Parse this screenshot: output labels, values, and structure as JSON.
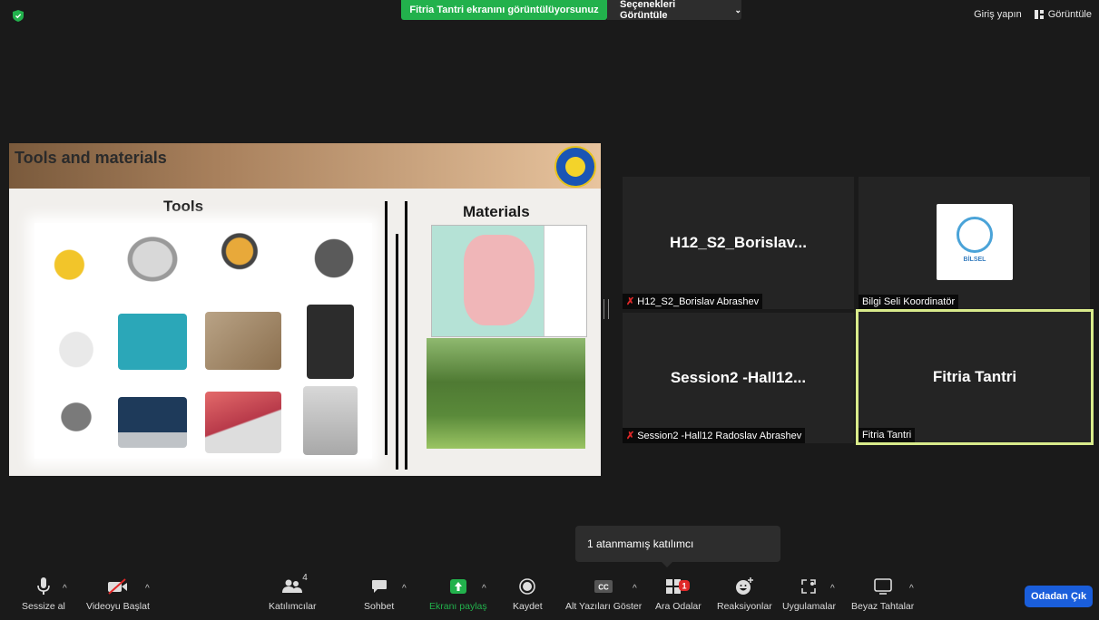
{
  "top_bar": {
    "share_banner": "Fitria Tantri ekranını görüntülüyorsunuz",
    "view_options": "Seçenekleri Görüntüle",
    "sign_in": "Giriş yapın",
    "view": "Görüntüle"
  },
  "slide": {
    "title": "Tools and materials",
    "tools_label": "Tools",
    "materials_label": "Materials"
  },
  "tiles": [
    {
      "name": "H12_S2_Borislav...",
      "label": "H12_S2_Borislav Abrashev",
      "muted": true
    },
    {
      "name": "",
      "label": "Bilgi Seli Koordinatör",
      "logo_text": "BİLSEL",
      "muted": false
    },
    {
      "name": "Session2 -Hall12...",
      "label": "Session2 -Hall12 Radoslav Abrashev",
      "muted": true
    },
    {
      "name": "Fitria Tantri",
      "label": "Fitria Tantri",
      "muted": false,
      "active": true
    }
  ],
  "tooltip": "1 atanmamış katılımcı",
  "toolbar": {
    "mute": "Sessize al",
    "video": "Videoyu Başlat",
    "participants": "Katılımcılar",
    "participants_count": "4",
    "chat": "Sohbet",
    "share": "Ekranı paylaş",
    "record": "Kaydet",
    "captions": "Alt Yazıları Göster",
    "breakout": "Ara Odalar",
    "breakout_badge": "1",
    "reactions": "Reaksiyonlar",
    "apps": "Uygulamalar",
    "whiteboard": "Beyaz Tahtalar",
    "leave": "Odadan Çık"
  },
  "colors": {
    "share_green": "#22b14c",
    "leave_blue": "#1a5edb",
    "active_border": "#d9eb8b",
    "muted_red": "#e02828"
  }
}
